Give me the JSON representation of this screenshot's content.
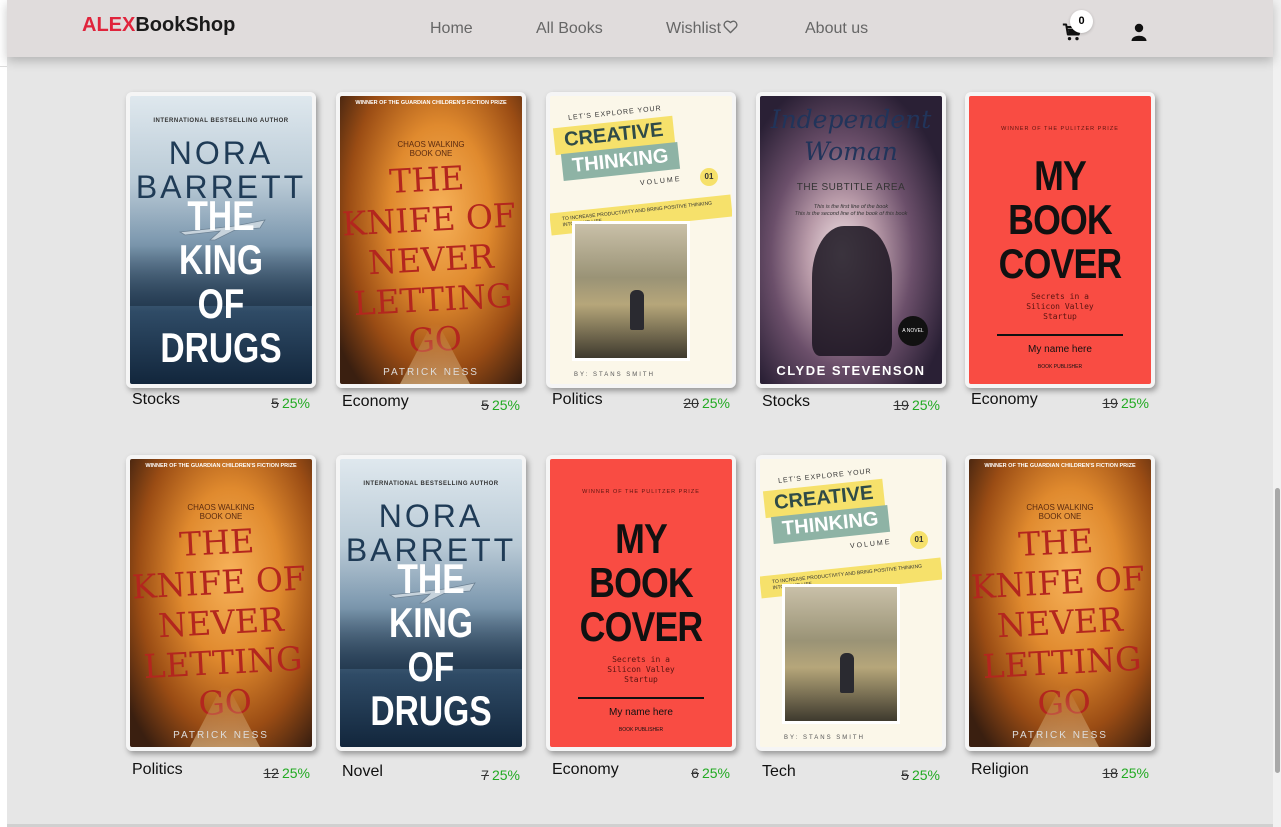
{
  "navbar": {
    "brand_accent": "ALEX",
    "brand_rest": "BookShop",
    "links": [
      "Home",
      "All Books",
      "Wishlist",
      "About us"
    ],
    "cart_count": "0"
  },
  "books": [
    {
      "cover": "nora",
      "category": "Stocks",
      "old_price": "5",
      "discount": "25%"
    },
    {
      "cover": "knife",
      "category": "Economy",
      "old_price": "5",
      "discount": "25%"
    },
    {
      "cover": "creative",
      "category": "Politics",
      "old_price": "20",
      "discount": "25%"
    },
    {
      "cover": "indep",
      "category": "Stocks",
      "old_price": "19",
      "discount": "25%"
    },
    {
      "cover": "mybook",
      "category": "Economy",
      "old_price": "19",
      "discount": "25%"
    },
    {
      "cover": "knife",
      "category": "Politics",
      "old_price": "12",
      "discount": "25%"
    },
    {
      "cover": "nora",
      "category": "Novel",
      "old_price": "7",
      "discount": "25%"
    },
    {
      "cover": "mybook",
      "category": "Economy",
      "old_price": "6",
      "discount": "25%"
    },
    {
      "cover": "creative",
      "category": "Tech",
      "old_price": "5",
      "discount": "25%"
    },
    {
      "cover": "knife",
      "category": "Religion",
      "old_price": "18",
      "discount": "25%"
    }
  ],
  "covers": {
    "nora": {
      "top": "INTERNATIONAL BESTSELLING AUTHOR",
      "author_1": "NORA",
      "author_2": "BARRETT",
      "title_1": "THE KING",
      "title_2": "OF DRUGS"
    },
    "knife": {
      "top": "WINNER OF THE GUARDIAN CHILDREN'S FICTION PRIZE",
      "series_1": "CHAOS WALKING",
      "series_2": "BOOK ONE",
      "title_1": "THE",
      "title_2": "KNIFE OF",
      "title_3": "NEVER",
      "title_4": "LETTING",
      "title_5": "GO",
      "author": "PATRICK NESS"
    },
    "creative": {
      "lets": "LET'S EXPLORE YOUR",
      "c1": "CREATIVE",
      "c2": "THINKING",
      "vol": "VOLUME",
      "num": "01",
      "band": "TO INCREASE PRODUCTIVITY AND BRING POSITIVE THINKING INTO YOUR LIFE",
      "by": "BY: STANS SMITH"
    },
    "indep": {
      "title_1": "Independent",
      "title_2": "Woman",
      "sub": "THE SUBTITLE AREA",
      "tiny_1": "This is the first line of the book",
      "tiny_2": "This is the second line of the book of this book",
      "novel": "A NOVEL",
      "author": "CLYDE STEVENSON"
    },
    "mybook": {
      "top": "WINNER OF THE PULITZER PRIZE",
      "title_1": "MY",
      "title_2": "BOOK",
      "title_3": "COVER",
      "sub_1": "Secrets in a",
      "sub_2": "Silicon Valley",
      "sub_3": "Startup",
      "name": "My name here",
      "pub": "BOOK PUBLISHER"
    }
  },
  "colors": {
    "brand_accent": "#e0243c",
    "discount": "#22aa22",
    "navbar_bg": "#e0dcdc",
    "page_bg": "#e6e6e6"
  }
}
